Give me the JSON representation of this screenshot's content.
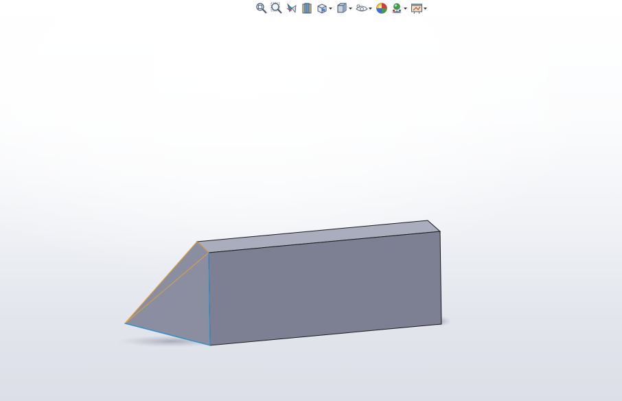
{
  "toolbar": {
    "buttons": [
      {
        "icon": "zoom-to-fit-icon",
        "has_dropdown": false
      },
      {
        "icon": "zoom-to-area-icon",
        "has_dropdown": false
      },
      {
        "icon": "previous-view-icon",
        "has_dropdown": false
      },
      {
        "icon": "section-view-icon",
        "has_dropdown": false
      },
      {
        "icon": "view-orientation-icon",
        "has_dropdown": true
      },
      {
        "icon": "display-style-icon",
        "has_dropdown": true
      },
      {
        "icon": "hide-show-items-icon",
        "has_dropdown": true
      },
      {
        "icon": "edit-appearance-icon",
        "has_dropdown": false
      },
      {
        "icon": "apply-scene-icon",
        "has_dropdown": true
      },
      {
        "icon": "view-settings-icon",
        "has_dropdown": true
      }
    ]
  },
  "model": {
    "face_color": "#7d8093",
    "top_color": "#a9adbd",
    "bevel_color": "#8e92a3",
    "edge_color": "#1a1a1a",
    "selected_edge_color_orange": "#e0a040",
    "selected_edge_color_blue": "#2a90d0"
  }
}
